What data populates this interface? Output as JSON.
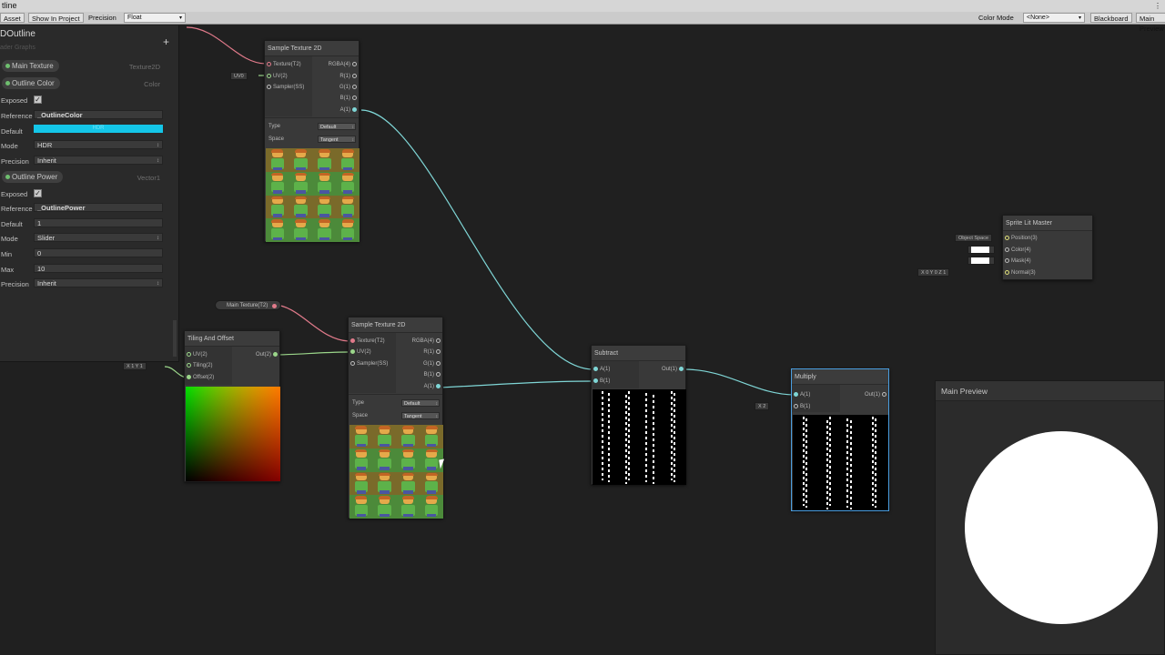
{
  "window": {
    "title": "tline"
  },
  "toolbar": {
    "asset": "Asset",
    "show_in_project": "Show In Project",
    "precision_label": "Precision",
    "precision_value": "Float",
    "color_mode_label": "Color Mode",
    "color_mode_value": "<None>",
    "blackboard": "Blackboard",
    "main_preview": "Main Preview"
  },
  "blackboard": {
    "title": "DOutline",
    "subtitle": "ader Graphs",
    "props": [
      {
        "name": "Main Texture",
        "type": "Texture2D"
      },
      {
        "name": "Outline Color",
        "type": "Color"
      },
      {
        "name": "Outline Power",
        "type": "Vector1"
      }
    ],
    "outline_color": {
      "exposed_label": "Exposed",
      "reference_label": "Reference",
      "reference": "_OutlineColor",
      "default_label": "Default",
      "default_text": "HDR",
      "default_color": "#14c6e8",
      "mode_label": "Mode",
      "mode": "HDR",
      "precision_label": "Precision",
      "precision": "Inherit"
    },
    "outline_power": {
      "exposed_label": "Exposed",
      "reference_label": "Reference",
      "reference": "_OutlinePower",
      "default_label": "Default",
      "default": "1",
      "mode_label": "Mode",
      "mode": "Slider",
      "min_label": "Min",
      "min": "0",
      "max_label": "Max",
      "max": "10",
      "precision_label": "Precision",
      "precision": "Inherit"
    }
  },
  "nodes": {
    "sample1": {
      "title": "Sample Texture 2D",
      "inputs": [
        "Texture(T2)",
        "UV(2)",
        "Sampler(SS)"
      ],
      "outputs": [
        "RGBA(4)",
        "R(1)",
        "G(1)",
        "B(1)",
        "A(1)"
      ],
      "type_label": "Type",
      "type_value": "Default",
      "space_label": "Space",
      "space_value": "Tangent",
      "uv_field": "UV0"
    },
    "sample2": {
      "title": "Sample Texture 2D",
      "inputs": [
        "Texture(T2)",
        "UV(2)",
        "Sampler(SS)"
      ],
      "outputs": [
        "RGBA(4)",
        "R(1)",
        "G(1)",
        "B(1)",
        "A(1)"
      ],
      "type_label": "Type",
      "type_value": "Default",
      "space_label": "Space",
      "space_value": "Tangent"
    },
    "tiling": {
      "title": "Tiling And Offset",
      "inputs": [
        "UV(2)",
        "Tiling(2)",
        "Offset(2)"
      ],
      "output": "Out(2)",
      "tiling_field": "X 1    Y 1"
    },
    "subtract": {
      "title": "Subtract",
      "inputs": [
        "A(1)",
        "B(1)"
      ],
      "output": "Out(1)"
    },
    "multiply": {
      "title": "Multiply",
      "inputs": [
        "A(1)",
        "B(1)"
      ],
      "output": "Out(1)",
      "b_field": "X  2"
    },
    "master": {
      "title": "Sprite Lit Master",
      "inputs": [
        "Position(3)",
        "Color(4)",
        "Mask(4)",
        "Normal(3)"
      ],
      "space_field": "Object Space",
      "normal_field": "X 0    Y 0    Z 1"
    },
    "main_texture_prop": {
      "label": "Main Texture(T2)"
    }
  },
  "preview": {
    "title": "Main Preview"
  }
}
